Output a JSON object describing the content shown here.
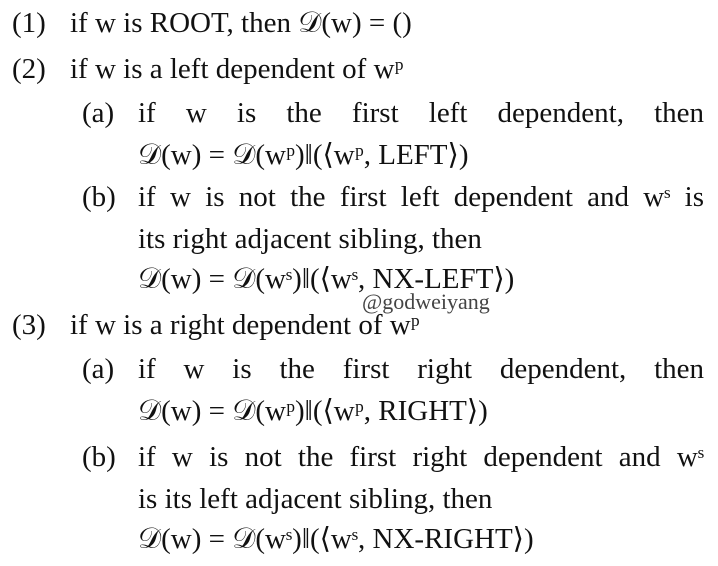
{
  "rules": {
    "r1": {
      "label": "(1)",
      "text": "if w is ROOT, then 𝒟(w) = ()"
    },
    "r2": {
      "label": "(2)",
      "text": "if w is a left dependent of wᵖ",
      "a": {
        "label": "(a)",
        "line1": "if w is the first left dependent, then",
        "line2": "𝒟(w) = 𝒟(wᵖ)‖(⟨wᵖ, LEFT⟩)"
      },
      "b": {
        "label": "(b)",
        "line1": "if w is not the first left dependent and wˢ is",
        "line2": "its right adjacent sibling, then",
        "line3": "𝒟(w) = 𝒟(wˢ)‖(⟨wˢ, NX-LEFT⟩)"
      }
    },
    "r3": {
      "label": "(3)",
      "text": "if w is a right dependent of wᵖ",
      "a": {
        "label": "(a)",
        "line1": "if w is the first right dependent, then",
        "line2": "𝒟(w) = 𝒟(wᵖ)‖(⟨wᵖ, RIGHT⟩)"
      },
      "b": {
        "label": "(b)",
        "line1": "if w is not the first right dependent and wˢ",
        "line2": "is its left adjacent sibling, then",
        "line3": "𝒟(w) = 𝒟(wˢ)‖(⟨wˢ, NX-RIGHT⟩)"
      }
    }
  },
  "watermark": "@godweiyang"
}
